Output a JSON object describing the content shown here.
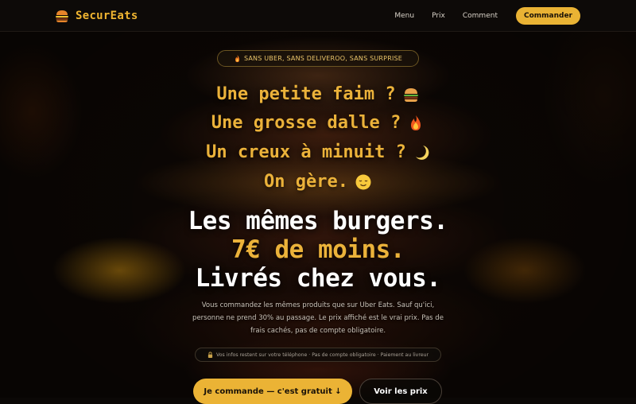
{
  "brand": {
    "name": "SecurEats",
    "logo_icon": "burger-icon",
    "accent": "#eab334"
  },
  "nav": {
    "links": [
      "Menu",
      "Prix",
      "Comment"
    ],
    "cta_label": "Commander"
  },
  "hero": {
    "badge": "SANS UBER, SANS DELIVEROO, SANS SURPRISE",
    "badge_icon": "fire-icon",
    "taglines": [
      {
        "text": "Une petite faim ?",
        "icon": "burger-emoji-icon"
      },
      {
        "text": "Une grosse dalle ?",
        "icon": "fire-emoji-icon"
      },
      {
        "text": "Un creux à minuit ?",
        "icon": "moon-emoji-icon"
      },
      {
        "text": "On gère.",
        "icon": "relieved-face-emoji-icon"
      }
    ],
    "headline": [
      "Les mêmes burgers.",
      "7€ de moins.",
      "Livrés chez vous."
    ],
    "description": "Vous commandez les mêmes produits que sur Uber Eats. Sauf qu'ici, personne ne prend 30% au passage. Le prix affiché est le vrai prix. Pas de frais cachés, pas de compte obligatoire.",
    "info_bar": "Vos infos restent sur votre téléphone · Pas de compte obligatoire · Paiement au livreur",
    "info_icon": "lock-icon",
    "primary_cta": "Je commande — c'est gratuit ↓",
    "secondary_cta": "Voir les prix"
  }
}
